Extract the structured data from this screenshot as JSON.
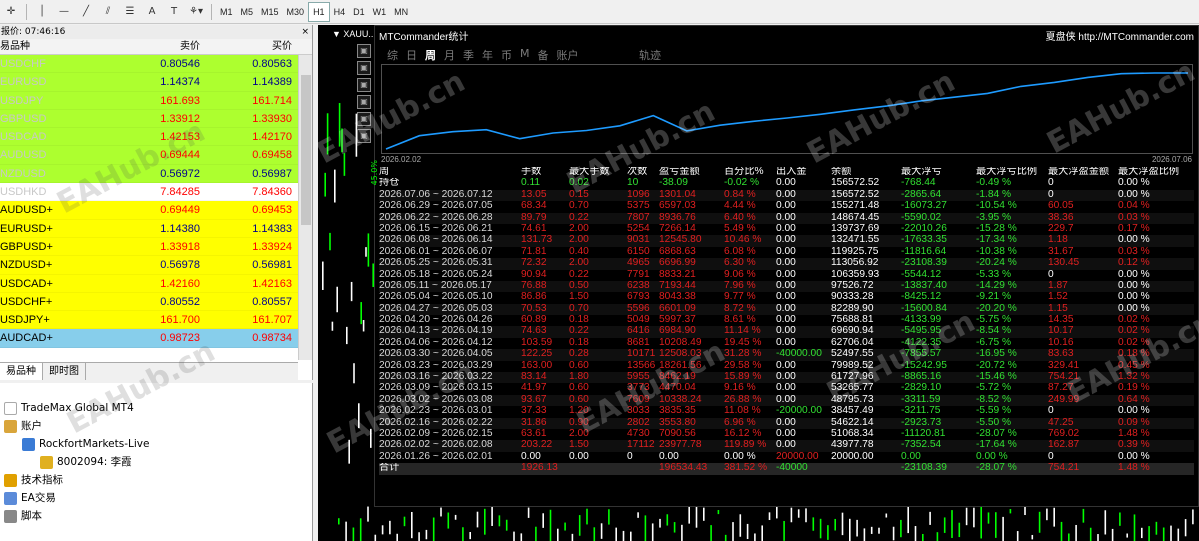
{
  "toolbar": {
    "timeframes": [
      "M1",
      "M5",
      "M15",
      "M30",
      "H1",
      "H4",
      "D1",
      "W1",
      "MN"
    ],
    "active_timeframe": "H1",
    "tool_labels": [
      "A",
      "T"
    ]
  },
  "market_watch": {
    "title_prefix": "报价: 07:46:16",
    "headers": {
      "symbol": "易品种",
      "bid": "卖价",
      "ask": "买价"
    },
    "rows": [
      {
        "symbol": "USDCHF",
        "bid": "0.80546",
        "ask": "0.80563",
        "bg": "#adff2f",
        "color": "#00008b",
        "symcolor": "#c8c8c8"
      },
      {
        "symbol": "EURUSD",
        "bid": "1.14374",
        "ask": "1.14389",
        "bg": "#adff2f",
        "color": "#00008b",
        "symcolor": "#c8c8c8"
      },
      {
        "symbol": "USDJPY",
        "bid": "161.693",
        "ask": "161.714",
        "bg": "#adff2f",
        "color": "#ff0000",
        "symcolor": "#c8c8c8"
      },
      {
        "symbol": "GBPUSD",
        "bid": "1.33912",
        "ask": "1.33930",
        "bg": "#adff2f",
        "color": "#ff0000",
        "symcolor": "#c8c8c8"
      },
      {
        "symbol": "USDCAD",
        "bid": "1.42153",
        "ask": "1.42170",
        "bg": "#adff2f",
        "color": "#ff0000",
        "symcolor": "#c8c8c8"
      },
      {
        "symbol": "AUDUSD",
        "bid": "0.69444",
        "ask": "0.69458",
        "bg": "#adff2f",
        "color": "#ff0000",
        "symcolor": "#c8c8c8"
      },
      {
        "symbol": "NZDUSD",
        "bid": "0.56972",
        "ask": "0.56987",
        "bg": "#adff2f",
        "color": "#00008b",
        "symcolor": "#c8c8c8"
      },
      {
        "symbol": "USDHKD",
        "bid": "7.84285",
        "ask": "7.84360",
        "bg": "#ffffff",
        "color": "#ff0000",
        "symcolor": "#c8c8c8"
      },
      {
        "symbol": "AUDUSD+",
        "bid": "0.69449",
        "ask": "0.69453",
        "bg": "#ffff00",
        "color": "#ff0000",
        "symcolor": "#000000"
      },
      {
        "symbol": "EURUSD+",
        "bid": "1.14380",
        "ask": "1.14383",
        "bg": "#ffff00",
        "color": "#00008b",
        "symcolor": "#000000"
      },
      {
        "symbol": "GBPUSD+",
        "bid": "1.33918",
        "ask": "1.33924",
        "bg": "#ffff00",
        "color": "#ff0000",
        "symcolor": "#000000"
      },
      {
        "symbol": "NZDUSD+",
        "bid": "0.56978",
        "ask": "0.56981",
        "bg": "#ffff00",
        "color": "#00008b",
        "symcolor": "#000000"
      },
      {
        "symbol": "USDCAD+",
        "bid": "1.42160",
        "ask": "1.42163",
        "bg": "#ffff00",
        "color": "#ff0000",
        "symcolor": "#000000"
      },
      {
        "symbol": "USDCHF+",
        "bid": "0.80552",
        "ask": "0.80557",
        "bg": "#ffff00",
        "color": "#00008b",
        "symcolor": "#000000"
      },
      {
        "symbol": "USDJPY+",
        "bid": "161.700",
        "ask": "161.707",
        "bg": "#ffff00",
        "color": "#ff0000",
        "symcolor": "#000000"
      },
      {
        "symbol": "AUDCAD+",
        "bid": "0.98723",
        "ask": "0.98734",
        "bg": "#87ceeb",
        "color": "#ff0000",
        "symcolor": "#000000"
      }
    ],
    "tabs": [
      "易品种",
      "即时图"
    ]
  },
  "navigator": {
    "items": [
      {
        "label": "TradeMax Global MT4",
        "indent": 0,
        "icon": "terminal-icon",
        "iconcolor": "#ffffff"
      },
      {
        "label": "账户",
        "indent": 0,
        "icon": "accounts-icon",
        "iconcolor": "#d9a53b"
      },
      {
        "label": "RockfortMarkets-Live",
        "indent": 1,
        "icon": "server-icon",
        "iconcolor": "#3a7bd5"
      },
      {
        "label": "8002094: 李霞",
        "indent": 2,
        "icon": "user-icon",
        "iconcolor": "#e0b020"
      },
      {
        "label": "技术指标",
        "indent": 0,
        "icon": "indicator-icon",
        "iconcolor": "#e0a000"
      },
      {
        "label": "EA交易",
        "indent": 0,
        "icon": "ea-icon",
        "iconcolor": "#5b8bd9"
      },
      {
        "label": "脚本",
        "indent": 0,
        "icon": "script-icon",
        "iconcolor": "#888888"
      }
    ]
  },
  "chart": {
    "symbol_label": "XAUU..."
  },
  "panel": {
    "title": "MTCommander统计",
    "right_brand": "夏盘侠",
    "url": "http://MTCommander.com",
    "tabs": [
      "综",
      "日",
      "周",
      "月",
      "季",
      "年",
      "币",
      "M",
      "备",
      "账户"
    ],
    "active_tab": "周",
    "track_label": "轨迹",
    "equity_start": "2026.02.02",
    "equity_end": "2026.07.06",
    "axis_label": "45.0%"
  },
  "stats": {
    "headers": [
      "周",
      "手数",
      "最大手数",
      "次数",
      "盈亏金额",
      "百分比%",
      "出入金",
      "余额",
      "最大浮亏",
      "最大浮亏比例",
      "最大浮盈金额",
      "最大浮盈比例"
    ],
    "holding": [
      "持仓",
      "0.11",
      "0.02",
      "10",
      "-38.09",
      "-0.02 %",
      "0.00",
      "156572.52",
      "-768.44",
      "-0.49 %",
      "0",
      "0.00 %"
    ],
    "rows": [
      [
        "2026.07.06 ~ 2026.07.12",
        "13.05",
        "0.15",
        "1096",
        "1301.04",
        "0.84 %",
        "0.00",
        "156572.52",
        "-2865.64",
        "-1.84 %",
        "0",
        "0.00 %"
      ],
      [
        "2026.06.29 ~ 2026.07.05",
        "68.34",
        "0.70",
        "5375",
        "6597.03",
        "4.44 %",
        "0.00",
        "155271.48",
        "-16073.27",
        "-10.54 %",
        "60.05",
        "0.04 %"
      ],
      [
        "2026.06.22 ~ 2026.06.28",
        "89.79",
        "0.22",
        "7807",
        "8936.76",
        "6.40 %",
        "0.00",
        "148674.45",
        "-5590.02",
        "-3.95 %",
        "38.36",
        "0.03 %"
      ],
      [
        "2026.06.15 ~ 2026.06.21",
        "74.61",
        "2.00",
        "5254",
        "7266.14",
        "5.49 %",
        "0.00",
        "139737.69",
        "-22010.26",
        "-15.28 %",
        "229.7",
        "0.17 %"
      ],
      [
        "2026.06.08 ~ 2026.06.14",
        "131.73",
        "2.00",
        "9031",
        "12545.80",
        "10.46 %",
        "0.00",
        "132471.55",
        "-17633.35",
        "-17.34 %",
        "1.18",
        "0.00 %"
      ],
      [
        "2026.06.01 ~ 2026.06.07",
        "71.81",
        "0.40",
        "6150",
        "6868.63",
        "6.08 %",
        "0.00",
        "119925.75",
        "-11816.64",
        "-10.38 %",
        "31.67",
        "0.03 %"
      ],
      [
        "2026.05.25 ~ 2026.05.31",
        "72.32",
        "2.00",
        "4965",
        "6696.99",
        "6.30 %",
        "0.00",
        "113056.92",
        "-23108.39",
        "-20.24 %",
        "130.45",
        "0.12 %"
      ],
      [
        "2026.05.18 ~ 2026.05.24",
        "90.94",
        "0.22",
        "7791",
        "8833.21",
        "9.06 %",
        "0.00",
        "106359.93",
        "-5544.12",
        "-5.33 %",
        "0",
        "0.00 %"
      ],
      [
        "2026.05.11 ~ 2026.05.17",
        "76.88",
        "0.50",
        "6238",
        "7193.44",
        "7.96 %",
        "0.00",
        "97526.72",
        "-13837.40",
        "-14.29 %",
        "1.87",
        "0.00 %"
      ],
      [
        "2026.05.04 ~ 2026.05.10",
        "86.86",
        "1.50",
        "6793",
        "8043.38",
        "9.77 %",
        "0.00",
        "90333.28",
        "-8425.12",
        "-9.21 %",
        "1.52",
        "0.00 %"
      ],
      [
        "2026.04.27 ~ 2026.05.03",
        "70.53",
        "0.70",
        "5596",
        "6601.09",
        "8.72 %",
        "0.00",
        "82289.90",
        "-15600.84",
        "-20.20 %",
        "1.15",
        "0.00 %"
      ],
      [
        "2026.04.20 ~ 2026.04.26",
        "60.89",
        "0.18",
        "5049",
        "5997.37",
        "8.61 %",
        "0.00",
        "75688.81",
        "-4133.99",
        "-5.75 %",
        "14.35",
        "0.02 %"
      ],
      [
        "2026.04.13 ~ 2026.04.19",
        "74.63",
        "0.22",
        "6416",
        "6984.90",
        "11.14 %",
        "0.00",
        "69690.94",
        "-5495.95",
        "-8.54 %",
        "10.17",
        "0.02 %"
      ],
      [
        "2026.04.06 ~ 2026.04.12",
        "103.59",
        "0.18",
        "8681",
        "10208.49",
        "19.45 %",
        "0.00",
        "62706.04",
        "-4122.35",
        "-6.75 %",
        "10.16",
        "0.02 %"
      ],
      [
        "2026.03.30 ~ 2026.04.05",
        "122.25",
        "0.28",
        "10171",
        "12508.03",
        "31.28 %",
        "-40000.00",
        "52497.55",
        "-7855.57",
        "-16.95 %",
        "83.63",
        "0.18 %"
      ],
      [
        "2026.03.23 ~ 2026.03.29",
        "163.00",
        "0.60",
        "13566",
        "18261.56",
        "29.58 %",
        "0.00",
        "79989.52",
        "-15242.95",
        "-20.72 %",
        "329.41",
        "0.45 %"
      ],
      [
        "2026.03.16 ~ 2026.03.22",
        "83.14",
        "1.80",
        "5955",
        "8462.19",
        "15.89 %",
        "0.00",
        "61727.96",
        "-8865.16",
        "-15.46 %",
        "754.21",
        "1.32 %"
      ],
      [
        "2026.03.09 ~ 2026.03.15",
        "41.97",
        "0.60",
        "3773",
        "4470.04",
        "9.16 %",
        "0.00",
        "53265.77",
        "-2829.10",
        "-5.72 %",
        "87.27",
        "0.19 %"
      ],
      [
        "2026.03.02 ~ 2026.03.08",
        "93.67",
        "0.60",
        "7609",
        "10338.24",
        "26.88 %",
        "0.00",
        "48795.73",
        "-3311.59",
        "-8.52 %",
        "249.99",
        "0.64 %"
      ],
      [
        "2026.02.23 ~ 2026.03.01",
        "37.33",
        "1.20",
        "3033",
        "3835.35",
        "11.08 %",
        "-20000.00",
        "38457.49",
        "-3211.75",
        "-5.59 %",
        "0",
        "0.00 %"
      ],
      [
        "2026.02.16 ~ 2026.02.22",
        "31.86",
        "0.90",
        "2802",
        "3553.80",
        "6.96 %",
        "0.00",
        "54622.14",
        "-2923.73",
        "-5.50 %",
        "47.25",
        "0.09 %"
      ],
      [
        "2026.02.09 ~ 2026.02.15",
        "63.61",
        "2.00",
        "4730",
        "7090.56",
        "16.12 %",
        "0.00",
        "51068.34",
        "-11120.81",
        "-28.07 %",
        "769.02",
        "1.48 %"
      ],
      [
        "2026.02.02 ~ 2026.02.08",
        "203.22",
        "1.50",
        "17112",
        "23977.78",
        "119.89 %",
        "0.00",
        "43977.78",
        "-7352.54",
        "-17.64 %",
        "162.87",
        "0.39 %"
      ],
      [
        "2026.01.26 ~ 2026.02.01",
        "0.00",
        "0.00",
        "0",
        "0.00",
        "0.00 %",
        "20000.00",
        "20000.00",
        "0.00",
        "0.00 %",
        "0",
        "0.00 %"
      ]
    ],
    "total": [
      "合计",
      "1926.13",
      "",
      "",
      "196534.43",
      "381.52 %",
      "-40000",
      "",
      "-23108.39",
      "-28.07 %",
      "754.21",
      "1.48 %"
    ]
  },
  "watermark": "EAHub.cn",
  "colors": {
    "positive": "#32e032",
    "negative": "#e02020",
    "equity_line": "#1e9bff"
  }
}
